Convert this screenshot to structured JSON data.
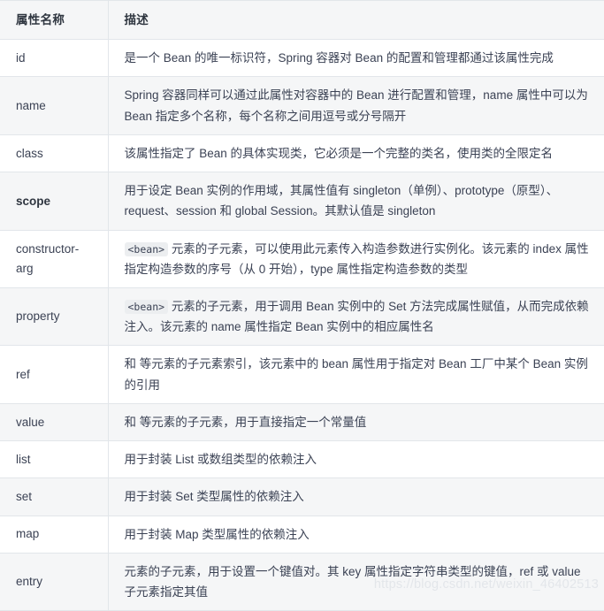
{
  "table": {
    "headers": {
      "name": "属性名称",
      "description": "描述"
    },
    "rows": [
      {
        "name": "id",
        "bold": false,
        "code_prefix": "",
        "description": "是一个 Bean 的唯一标识符，Spring 容器对 Bean 的配置和管理都通过该属性完成"
      },
      {
        "name": "name",
        "bold": false,
        "code_prefix": "",
        "description": "Spring 容器同样可以通过此属性对容器中的 Bean 进行配置和管理，name 属性中可以为 Bean 指定多个名称，每个名称之间用逗号或分号隔开"
      },
      {
        "name": "class",
        "bold": false,
        "code_prefix": "",
        "description": "该属性指定了 Bean 的具体实现类，它必须是一个完整的类名，使用类的全限定名"
      },
      {
        "name": "scope",
        "bold": true,
        "code_prefix": "",
        "description": "用于设定 Bean 实例的作用域，其属性值有 singleton（单例）、prototype（原型）、request、session 和 global Session。其默认值是 singleton"
      },
      {
        "name": "constructor-arg",
        "bold": false,
        "code_prefix": "<bean>",
        "description": "元素的子元素，可以使用此元素传入构造参数进行实例化。该元素的 index 属性指定构造参数的序号（从 0 开始），type 属性指定构造参数的类型"
      },
      {
        "name": "property",
        "bold": false,
        "code_prefix": "<bean>",
        "description": "元素的子元素，用于调用 Bean 实例中的 Set 方法完成属性赋值，从而完成依赖注入。该元素的 name 属性指定 Bean 实例中的相应属性名"
      },
      {
        "name": "ref",
        "bold": false,
        "code_prefix": "",
        "description": "和 等元素的子元素索引，该元素中的 bean 属性用于指定对 Bean 工厂中某个 Bean 实例的引用"
      },
      {
        "name": "value",
        "bold": false,
        "code_prefix": "",
        "description": "和 等元素的子元素，用于直接指定一个常量值"
      },
      {
        "name": "list",
        "bold": false,
        "code_prefix": "",
        "description": "用于封装 List 或数组类型的依赖注入"
      },
      {
        "name": "set",
        "bold": false,
        "code_prefix": "",
        "description": "用于封装 Set 类型属性的依赖注入"
      },
      {
        "name": "map",
        "bold": false,
        "code_prefix": "",
        "description": "用于封装 Map 类型属性的依赖注入"
      },
      {
        "name": "entry",
        "bold": false,
        "code_prefix": "",
        "description": "元素的子元素，用于设置一个键值对。其 key 属性指定字符串类型的键值，ref 或 value 子元素指定其值"
      }
    ]
  },
  "watermark": {
    "text": "https://blog.csdn.net/weixin_46402513"
  },
  "colors": {
    "stripe": "#f5f6f7",
    "border": "#e2e6ea",
    "text": "#3b4254",
    "code_bg": "#eceef0",
    "watermark": "#e3e6ea"
  }
}
